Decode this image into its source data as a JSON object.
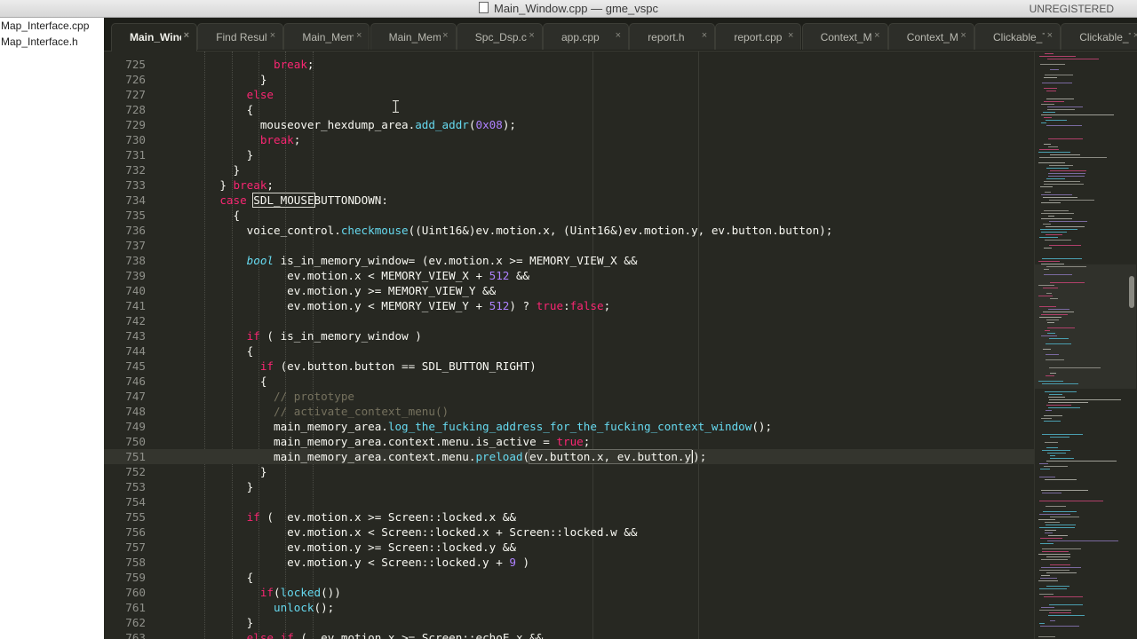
{
  "window": {
    "title": "Main_Window.cpp — gme_vspc",
    "license_status": "UNREGISTERED"
  },
  "sidebar": {
    "items": [
      {
        "label": "Map_Interface.cpp"
      },
      {
        "label": "Map_Interface.h"
      }
    ]
  },
  "tabs": [
    {
      "label": "Main_Window.cpp",
      "active": true
    },
    {
      "label": "Find Results",
      "active": false
    },
    {
      "label": "Main_Memory_Area.cpp",
      "active": false
    },
    {
      "label": "Main_Memory_Area.h",
      "active": false
    },
    {
      "label": "Spc_Dsp.cpp",
      "active": false
    },
    {
      "label": "app.cpp",
      "active": false
    },
    {
      "label": "report.h",
      "active": false
    },
    {
      "label": "report.cpp",
      "active": false
    },
    {
      "label": "Context_Menu.cpp",
      "active": false
    },
    {
      "label": "Context_Menu.h",
      "active": false
    },
    {
      "label": "Clickable_Text.cpp",
      "active": false
    },
    {
      "label": "Clickable_Text.h",
      "active": false
    }
  ],
  "tab_close_glyph": "×",
  "editor": {
    "current_line": 751,
    "lines": [
      {
        "n": 725,
        "text": "            break;"
      },
      {
        "n": 726,
        "text": "          }"
      },
      {
        "n": 727,
        "text": "        else"
      },
      {
        "n": 728,
        "text": "        {"
      },
      {
        "n": 729,
        "text": "          mouseover_hexdump_area.add_addr(0x08);"
      },
      {
        "n": 730,
        "text": "          break;"
      },
      {
        "n": 731,
        "text": "        }"
      },
      {
        "n": 732,
        "text": "      }"
      },
      {
        "n": 733,
        "text": "    } break;"
      },
      {
        "n": 734,
        "text": "    case SDL_MOUSEBUTTONDOWN:"
      },
      {
        "n": 735,
        "text": "      {"
      },
      {
        "n": 736,
        "text": "        voice_control.checkmouse((Uint16&)ev.motion.x, (Uint16&)ev.motion.y, ev.button.button);"
      },
      {
        "n": 737,
        "text": ""
      },
      {
        "n": 738,
        "text": "        bool is_in_memory_window= (ev.motion.x >= MEMORY_VIEW_X &&"
      },
      {
        "n": 739,
        "text": "              ev.motion.x < MEMORY_VIEW_X + 512 &&"
      },
      {
        "n": 740,
        "text": "              ev.motion.y >= MEMORY_VIEW_Y &&"
      },
      {
        "n": 741,
        "text": "              ev.motion.y < MEMORY_VIEW_Y + 512) ? true:false;"
      },
      {
        "n": 742,
        "text": ""
      },
      {
        "n": 743,
        "text": "        if ( is_in_memory_window )"
      },
      {
        "n": 744,
        "text": "        {"
      },
      {
        "n": 745,
        "text": "          if (ev.button.button == SDL_BUTTON_RIGHT)"
      },
      {
        "n": 746,
        "text": "          {"
      },
      {
        "n": 747,
        "text": "            // prototype"
      },
      {
        "n": 748,
        "text": "            // activate_context_menu()"
      },
      {
        "n": 749,
        "text": "            main_memory_area.log_the_fucking_address_for_the_fucking_context_window();"
      },
      {
        "n": 750,
        "text": "            main_memory_area.context.menu.is_active = true;"
      },
      {
        "n": 751,
        "text": "            main_memory_area.context.menu.preload(ev.button.x, ev.button.y);"
      },
      {
        "n": 752,
        "text": "          }"
      },
      {
        "n": 753,
        "text": "        }"
      },
      {
        "n": 754,
        "text": ""
      },
      {
        "n": 755,
        "text": "        if (  ev.motion.x >= Screen::locked.x &&"
      },
      {
        "n": 756,
        "text": "              ev.motion.x < Screen::locked.x + Screen::locked.w &&"
      },
      {
        "n": 757,
        "text": "              ev.motion.y >= Screen::locked.y &&"
      },
      {
        "n": 758,
        "text": "              ev.motion.y < Screen::locked.y + 9 )"
      },
      {
        "n": 759,
        "text": "        {"
      },
      {
        "n": 760,
        "text": "          if(locked())"
      },
      {
        "n": 761,
        "text": "            unlock();"
      },
      {
        "n": 762,
        "text": "        }"
      },
      {
        "n": 763,
        "text": "        else if (  ev.motion.x >= Screen::echoE.x &&"
      }
    ]
  },
  "colors": {
    "background": "#272822",
    "text": "#f8f8f2",
    "keyword": "#f92672",
    "function": "#66d9ef",
    "number": "#ae81ff",
    "comment": "#75715e",
    "gutter_text": "#8f908a",
    "current_line": "#34352e"
  }
}
